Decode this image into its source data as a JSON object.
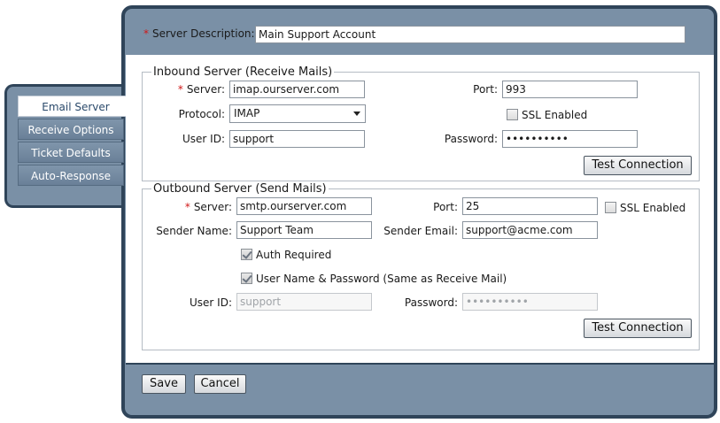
{
  "tabs": [
    {
      "label": "Email Server",
      "active": true
    },
    {
      "label": "Receive Options",
      "active": false
    },
    {
      "label": "Ticket Defaults",
      "active": false
    },
    {
      "label": "Auto-Response",
      "active": false
    }
  ],
  "server_description": {
    "label": "Server Description:",
    "value": "Main Support Account"
  },
  "inbound": {
    "legend": "Inbound Server (Receive Mails)",
    "server_label": "Server:",
    "server_value": "imap.ourserver.com",
    "port_label": "Port:",
    "port_value": "993",
    "protocol_label": "Protocol:",
    "protocol_value": "IMAP",
    "ssl_label": "SSL Enabled",
    "ssl_checked": false,
    "userid_label": "User ID:",
    "userid_value": "support",
    "password_label": "Password:",
    "password_value": "••••••••••",
    "test_button": "Test Connection"
  },
  "outbound": {
    "legend": "Outbound Server (Send Mails)",
    "server_label": "Server:",
    "server_value": "smtp.ourserver.com",
    "port_label": "Port:",
    "port_value": "25",
    "ssl_label": "SSL Enabled",
    "ssl_checked": false,
    "sender_name_label": "Sender Name:",
    "sender_name_value": "Support Team",
    "sender_email_label": "Sender Email:",
    "sender_email_value": "support@acme.com",
    "auth_label": "Auth Required",
    "auth_checked": true,
    "same_creds_label": "User Name & Password (Same as Receive Mail)",
    "same_creds_checked": true,
    "userid_label": "User ID:",
    "userid_value": "support",
    "password_label": "Password:",
    "password_value": "••••••••••",
    "test_button": "Test Connection"
  },
  "footer": {
    "save_label": "Save",
    "cancel_label": "Cancel"
  },
  "colors": {
    "frame": "#7a90a6",
    "border": "#2f4459",
    "required": "#d01818",
    "active_tab_text": "#2b4a6b"
  }
}
